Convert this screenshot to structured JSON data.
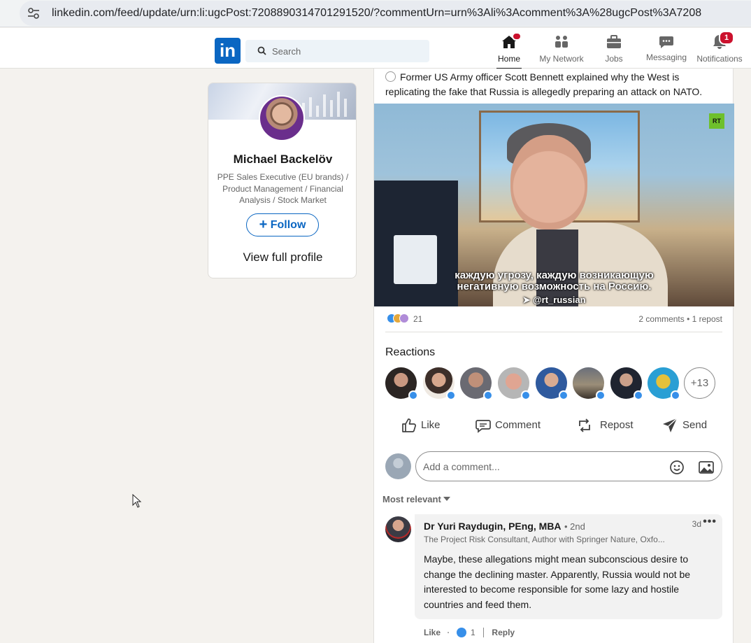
{
  "browser": {
    "url": "linkedin.com/feed/update/urn:li:ugcPost:7208890314701291520/?commentUrn=urn%3Ali%3Acomment%3A%28ugcPost%3A7208"
  },
  "nav": {
    "logo": "in",
    "search_placeholder": "Search",
    "items": [
      {
        "label": "Home",
        "icon": "home-icon"
      },
      {
        "label": "My Network",
        "icon": "my-network-icon"
      },
      {
        "label": "Jobs",
        "icon": "jobs-icon"
      },
      {
        "label": "Messaging",
        "icon": "messaging-icon"
      },
      {
        "label": "Notifications",
        "icon": "notifications-icon",
        "badge": "1"
      }
    ]
  },
  "profile": {
    "name": "Michael Backelöv",
    "headline": "PPE Sales Executive (EU brands) / Product Management / Financial Analysis / Stock Market",
    "follow_label": "Follow",
    "view_profile": "View full profile"
  },
  "post": {
    "text": "Former US Army officer Scott Bennett explained why the West is replicating the fake that Russia is allegedly preparing an attack on NATO.",
    "video": {
      "caption_line1": "каждую угрозу, каждую возникающую",
      "caption_line2": "негативную возможность на Россию.",
      "handle": "@rt_russian",
      "rt_logo": "RT"
    },
    "reactions_count": "21",
    "comments_reposts": "2 comments • 1 repost",
    "reactions_title": "Reactions",
    "more_reactors": "+13",
    "actions": {
      "like": "Like",
      "comment": "Comment",
      "repost": "Repost",
      "send": "Send"
    },
    "comment_placeholder": "Add a comment...",
    "sort_label": "Most relevant"
  },
  "comment": {
    "author": "Dr Yuri Raydugin, PEng, MBA",
    "degree": "• 2nd",
    "time": "3d",
    "more": "•••",
    "headline": "The Project Risk Consultant, Author with Springer Nature, Oxfo...",
    "text": "Maybe, these allegations might mean subconscious desire to change the declining master. Apparently, Russia would not be interested to become responsible for some lazy and hostile countries and feed them.",
    "like_label": "Like",
    "like_count": "1",
    "reply_label": "Reply"
  },
  "colors": {
    "linkedin_blue": "#0a66c2",
    "badge_red": "#cb112d",
    "page_bg": "#f4f2ee",
    "like_blue": "#378fe9"
  }
}
